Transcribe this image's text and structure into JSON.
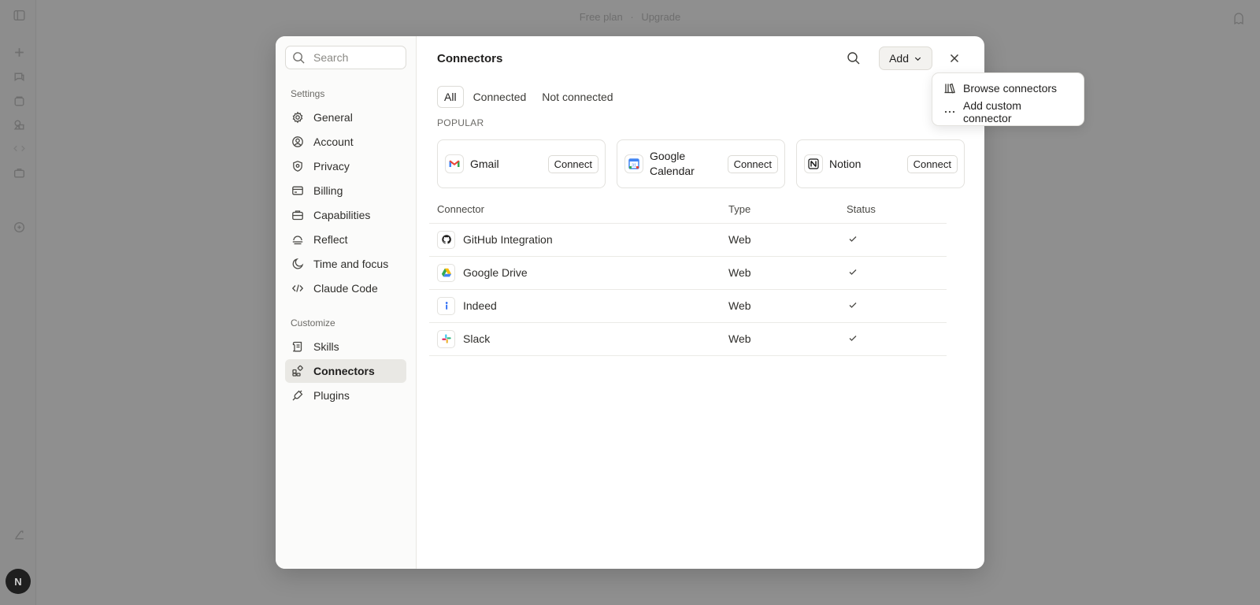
{
  "top_bar": {
    "plan": "Free plan",
    "separator": "·",
    "upgrade": "Upgrade"
  },
  "avatar": {
    "initial": "N"
  },
  "sidebar": {
    "search_placeholder": "Search",
    "settings_label": "Settings",
    "settings_items": [
      {
        "label": "General",
        "icon": "gear-icon"
      },
      {
        "label": "Account",
        "icon": "user-circle-icon"
      },
      {
        "label": "Privacy",
        "icon": "shield-icon"
      },
      {
        "label": "Billing",
        "icon": "credit-card-icon"
      },
      {
        "label": "Capabilities",
        "icon": "briefcase-icon"
      },
      {
        "label": "Reflect",
        "icon": "reflect-icon"
      },
      {
        "label": "Time and focus",
        "icon": "moon-icon"
      },
      {
        "label": "Claude Code",
        "icon": "code-icon"
      }
    ],
    "customize_label": "Customize",
    "customize_items": [
      {
        "label": "Skills",
        "icon": "scroll-icon"
      },
      {
        "label": "Connectors",
        "icon": "connectors-icon",
        "active": true
      },
      {
        "label": "Plugins",
        "icon": "plug-icon"
      }
    ]
  },
  "main": {
    "title": "Connectors",
    "add_label": "Add",
    "tabs": [
      "All",
      "Connected",
      "Not connected"
    ],
    "active_tab": "All",
    "popular_label": "POPULAR",
    "popular": [
      {
        "name": "Gmail",
        "button": "Connect",
        "icon": "gmail-icon"
      },
      {
        "name": "Google Calendar",
        "button": "Connect",
        "icon": "google-calendar-icon"
      },
      {
        "name": "Notion",
        "button": "Connect",
        "icon": "notion-icon"
      }
    ],
    "table": {
      "headers": [
        "Connector",
        "Type",
        "Status"
      ],
      "rows": [
        {
          "name": "GitHub Integration",
          "type": "Web",
          "icon": "github-icon",
          "connected": true
        },
        {
          "name": "Google Drive",
          "type": "Web",
          "icon": "google-drive-icon",
          "connected": true
        },
        {
          "name": "Indeed",
          "type": "Web",
          "icon": "indeed-icon",
          "connected": true
        },
        {
          "name": "Slack",
          "type": "Web",
          "icon": "slack-icon",
          "connected": true
        }
      ]
    }
  },
  "dropdown": {
    "items": [
      {
        "label": "Browse connectors",
        "icon": "library-icon"
      },
      {
        "label": "Add custom connector",
        "icon": "more-horizontal-icon"
      }
    ]
  },
  "colors": {
    "overlay": "#8f8f8f",
    "modal_bg": "#ffffff",
    "sidebar_bg": "#fbfbfa",
    "active_nav": "#e9e8e4"
  }
}
